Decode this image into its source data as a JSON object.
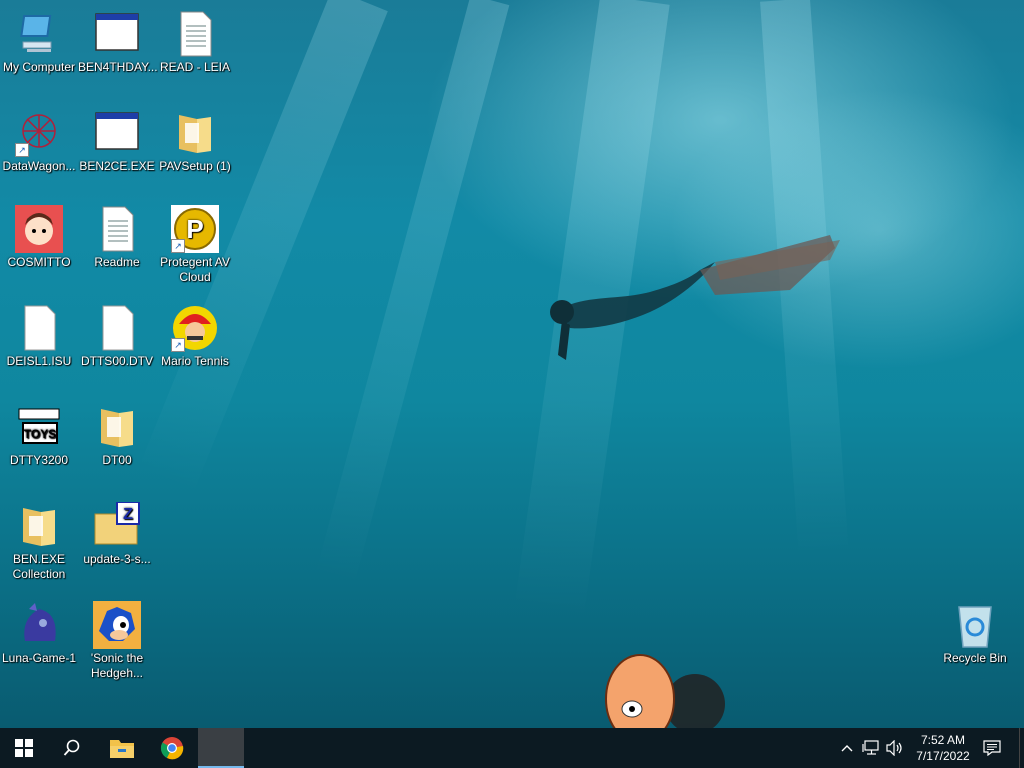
{
  "desktop": {
    "icons": [
      {
        "label": "My Computer",
        "icon": "computer-icon"
      },
      {
        "label": "BEN4THDAY...",
        "icon": "program-window-icon"
      },
      {
        "label": "READ - LEIA",
        "icon": "text-document-icon"
      },
      {
        "label": "DataWagon...",
        "icon": "datawagon-icon"
      },
      {
        "label": "BEN2CE.EXE",
        "icon": "program-window-icon"
      },
      {
        "label": "PAVSetup (1)",
        "icon": "folder-icon"
      },
      {
        "label": "COSMITTO",
        "icon": "cosmitto-avatar-icon"
      },
      {
        "label": "Readme",
        "icon": "text-document-icon"
      },
      {
        "label": "Protegent  AV Cloud",
        "icon": "protegent-icon"
      },
      {
        "label": "DEISL1.ISU",
        "icon": "blank-file-icon"
      },
      {
        "label": "DTTS00.DTV",
        "icon": "blank-file-icon"
      },
      {
        "label": "Mario Tennis",
        "icon": "mario-tennis-icon"
      },
      {
        "label": "DTTY3200",
        "icon": "desktop-toys-icon"
      },
      {
        "label": "DT00",
        "icon": "folder-icon"
      },
      {
        "label": "BEN.EXE Collection",
        "icon": "folder-icon"
      },
      {
        "label": "update-3-s...",
        "icon": "zip-folder-icon"
      },
      {
        "label": "Luna-Game-1",
        "icon": "luna-icon"
      },
      {
        "label": "'Sonic the Hedgeh...",
        "icon": "sonic-icon"
      },
      {
        "label": "Recycle Bin",
        "icon": "recycle-bin-icon"
      }
    ]
  },
  "taskbar": {
    "start_icon": "windows-start-icon",
    "search_icon": "search-icon",
    "pinned": [
      "file-explorer-icon",
      "chrome-icon"
    ],
    "tray": {
      "icons": [
        "chevron-up-icon",
        "network-icon",
        "volume-icon"
      ],
      "time": "7:52 AM",
      "date": "7/17/2022",
      "notification_icon": "notification-icon"
    }
  },
  "colors": {
    "taskbar": "#0c1a22",
    "accent": "#0078d7"
  }
}
